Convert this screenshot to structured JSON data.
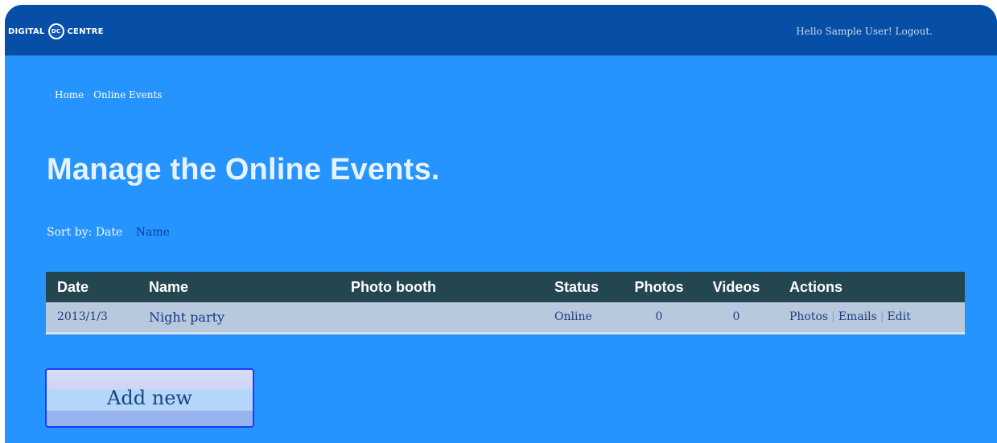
{
  "header": {
    "logo_left": "DIGITAL",
    "logo_mark": "DC",
    "logo_right": "CENTRE",
    "greeting": "Hello Sample User!",
    "logout_label": "Logout."
  },
  "breadcrumb": {
    "home": "Home",
    "current": "Online Events"
  },
  "page_title": "Manage the Online Events.",
  "sort": {
    "label": "Sort by: Date",
    "name_option": "Name"
  },
  "table": {
    "columns": [
      "Date",
      "Name",
      "Photo booth",
      "Status",
      "Photos",
      "Videos",
      "Actions"
    ],
    "rows": [
      {
        "date": "2013/1/3",
        "name": "Night party",
        "photo_booth": "",
        "status": "Online",
        "photos": "0",
        "videos": "0",
        "actions": [
          "Photos",
          "Emails",
          "Edit"
        ]
      }
    ]
  },
  "add_button_label": "Add new",
  "colors": {
    "background": "#2694fe",
    "topbar": "#064ea6",
    "table_header": "#244650",
    "table_row": "#b9c9dd"
  }
}
